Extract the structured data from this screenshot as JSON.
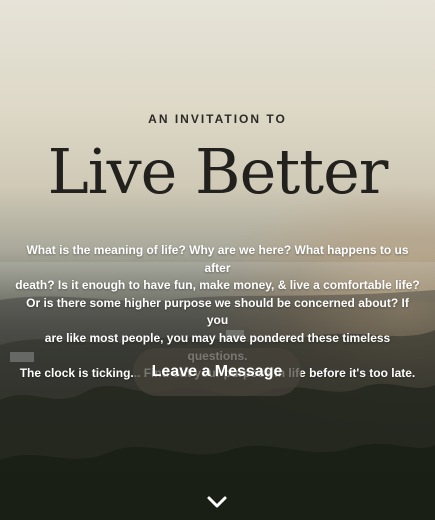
{
  "hero": {
    "eyebrow": "AN INVITATION TO",
    "title": "Live Better",
    "body_lines": [
      "What is the meaning of life? Why are we here? What happens to us after",
      "death? Is it enough to have fun, make money, & live a comfortable life?",
      "Or is there some higher purpose we should be concerned about? If you",
      "are like most people, you may have pondered these timeless questions.",
      "The clock is ticking... Find out your purpose in life before it's too late."
    ],
    "cta_label": "Leave a Message",
    "scroll_icon": "chevron-down-icon"
  },
  "colors": {
    "text_dark": "#22211d",
    "text_light": "#ffffff",
    "button_bg": "#46423a"
  }
}
